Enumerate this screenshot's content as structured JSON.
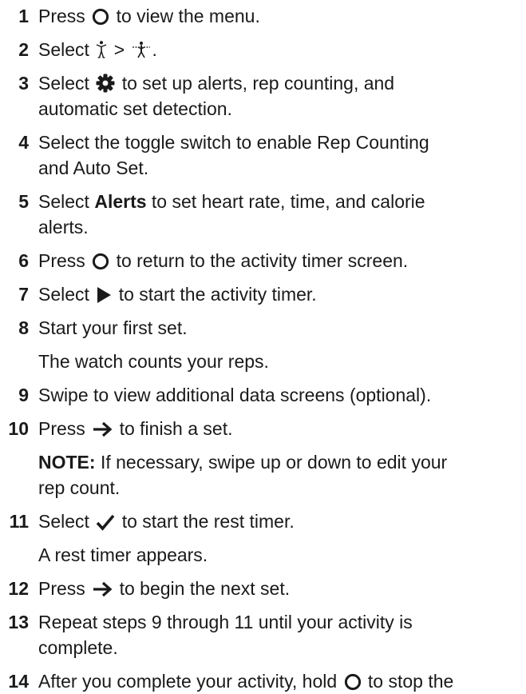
{
  "steps": [
    {
      "num": "1",
      "pre": "Press",
      "icon": "circle-button-icon",
      "post": "to view the menu."
    },
    {
      "num": "2",
      "pre": "Select",
      "icon": "person-icon",
      "mid": ">",
      "icon2": "weightlifting-icon",
      "post": "."
    },
    {
      "num": "3",
      "pre": "Select",
      "icon": "gear-icon",
      "post": "to set up alerts, rep counting, and",
      "line2": "automatic set detection."
    },
    {
      "num": "4",
      "text": "Select the toggle switch to enable Rep Counting",
      "line2": "and Auto Set."
    },
    {
      "num": "5",
      "pre": "Select",
      "bold": "Alerts",
      "post": "to set heart rate, time, and calorie",
      "line2": "alerts."
    },
    {
      "num": "6",
      "pre": "Press",
      "icon": "circle-button-icon",
      "post": "to return to the activity timer screen."
    },
    {
      "num": "7",
      "pre": "Select",
      "icon": "play-icon",
      "post": "to start the activity timer."
    },
    {
      "num": "8",
      "text": "Start your first set.",
      "sub": "The watch counts your reps."
    },
    {
      "num": "9",
      "text": "Swipe to view additional data screens (optional)."
    },
    {
      "num": "10",
      "pre": "Press",
      "icon": "arrow-right-icon",
      "post": "to finish a set.",
      "note_label": "NOTE:",
      "note_text": "If necessary, swipe up or down to edit your",
      "note_line2": "rep count."
    },
    {
      "num": "11",
      "pre": "Select",
      "icon": "checkmark-icon",
      "post": "to start the rest timer.",
      "sub": "A rest timer appears."
    },
    {
      "num": "12",
      "pre": "Press",
      "icon": "arrow-right-icon",
      "post": "to begin the next set."
    },
    {
      "num": "13",
      "text": "Repeat steps 9 through 11 until your activity is",
      "line2": "complete."
    },
    {
      "num": "14",
      "pre": "After you complete your activity, hold",
      "icon": "circle-button-icon",
      "post": "to stop the"
    }
  ]
}
